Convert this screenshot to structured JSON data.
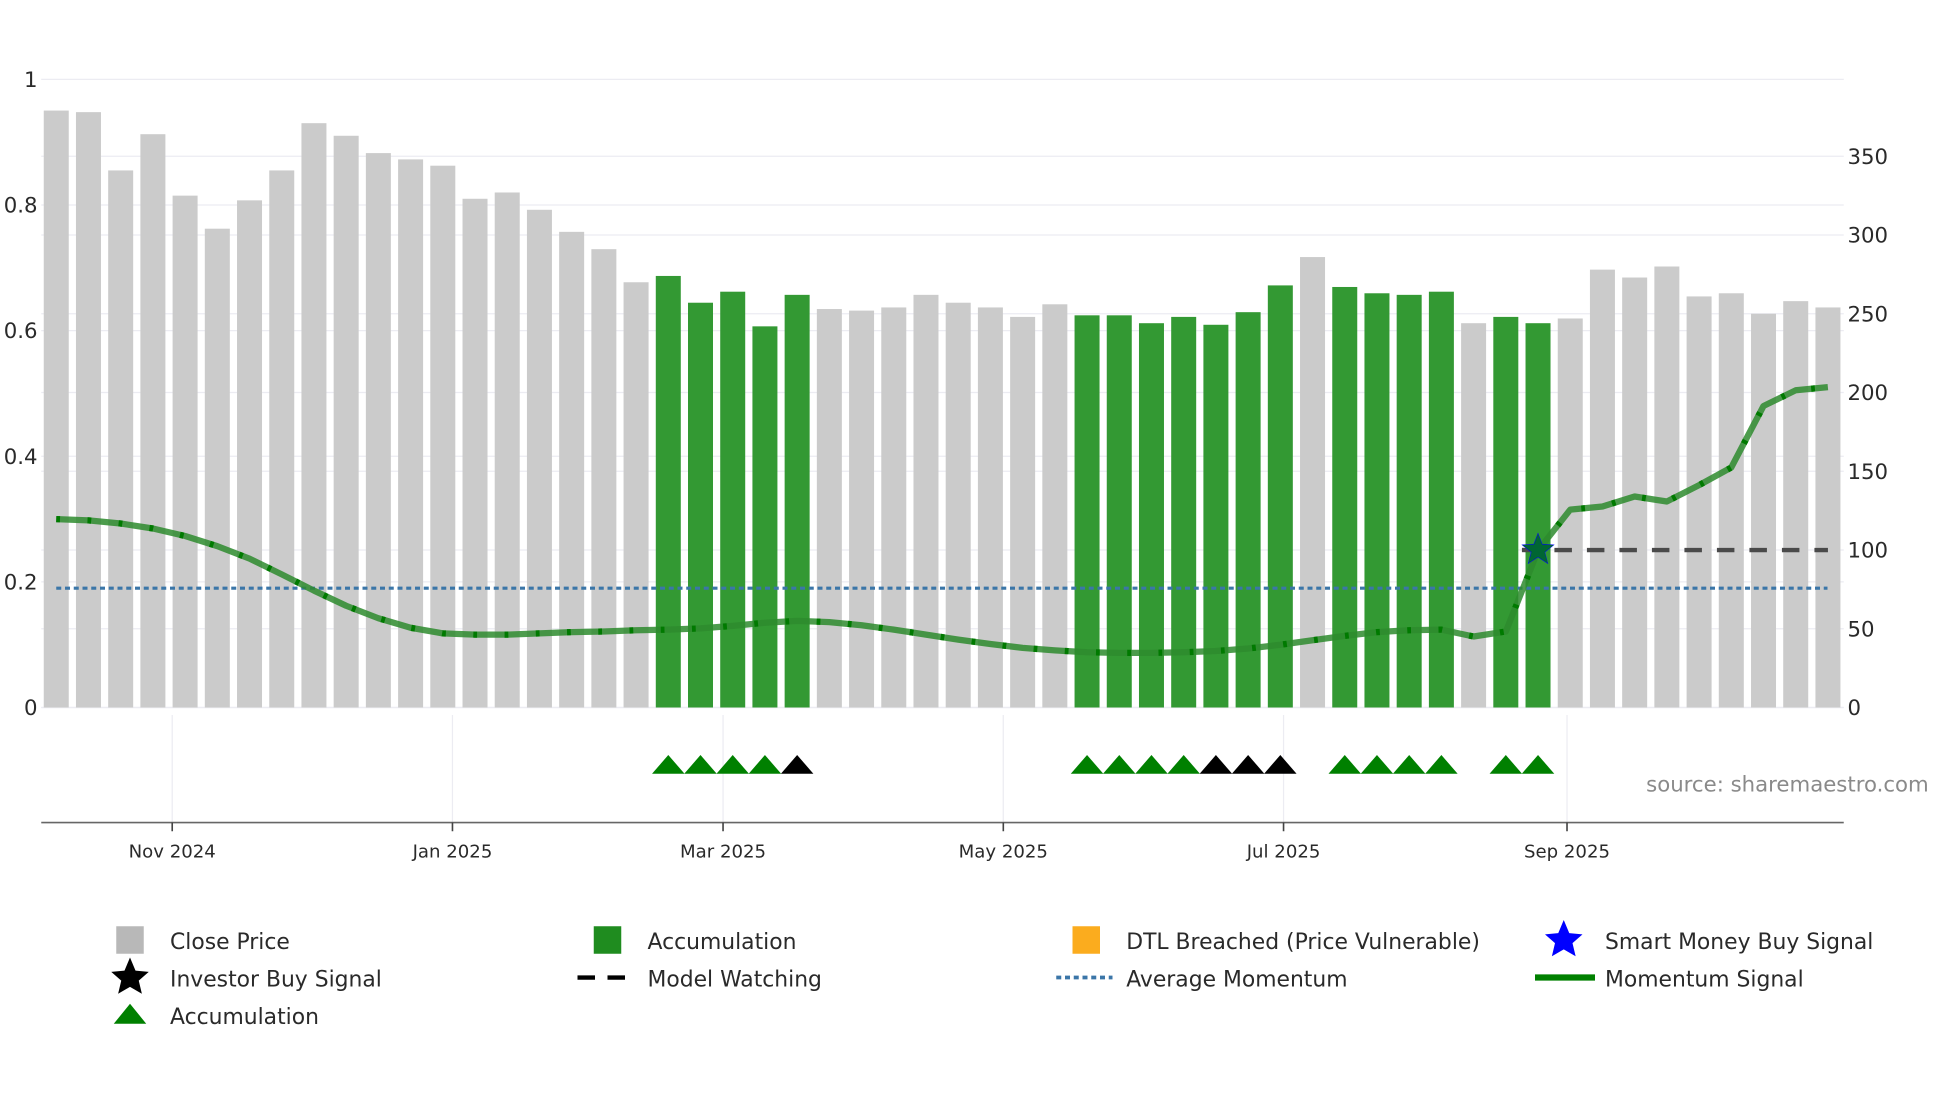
{
  "chart_data": {
    "type": "bar",
    "source": "source: sharemaestro.com",
    "left_axis": {
      "ticks": [
        "0",
        "0.2",
        "0.4",
        "0.6",
        "0.8",
        "1"
      ],
      "range": [
        0,
        1
      ]
    },
    "right_axis": {
      "ticks": [
        "0",
        "50",
        "100",
        "150",
        "200",
        "250",
        "300",
        "350"
      ],
      "range": [
        0,
        400
      ]
    },
    "x_ticks": [
      {
        "label": "Nov 2024",
        "bar_index": 3.6
      },
      {
        "label": "Jan 2025",
        "bar_index": 12.3
      },
      {
        "label": "Mar 2025",
        "bar_index": 20.7
      },
      {
        "label": "May 2025",
        "bar_index": 29.4
      },
      {
        "label": "Jul 2025",
        "bar_index": 38.1
      },
      {
        "label": "Sep 2025",
        "bar_index": 46.9
      }
    ],
    "close_price": [
      379,
      378,
      341,
      364,
      325,
      304,
      322,
      341,
      371,
      363,
      352,
      348,
      344,
      323,
      327,
      316,
      302,
      291,
      270,
      274,
      257,
      264,
      242,
      262,
      253,
      252,
      254,
      262,
      257,
      254,
      248,
      256,
      249,
      249,
      244,
      248,
      243,
      251,
      268,
      286,
      267,
      263,
      262,
      264,
      244,
      248,
      244,
      247,
      278,
      273,
      280,
      261,
      263,
      250,
      258,
      254
    ],
    "accumulation_bars": [
      19,
      20,
      21,
      22,
      23,
      32,
      33,
      34,
      35,
      36,
      37,
      38,
      40,
      41,
      42,
      43,
      45,
      46
    ],
    "momentum_signal": [
      0.3,
      0.298,
      0.293,
      0.285,
      0.273,
      0.257,
      0.237,
      0.212,
      0.186,
      0.162,
      0.142,
      0.127,
      0.118,
      0.116,
      0.116,
      0.118,
      0.12,
      0.121,
      0.123,
      0.124,
      0.126,
      0.13,
      0.135,
      0.138,
      0.136,
      0.131,
      0.124,
      0.116,
      0.108,
      0.101,
      0.095,
      0.091,
      0.088,
      0.087,
      0.087,
      0.088,
      0.09,
      0.094,
      0.1,
      0.107,
      0.114,
      0.12,
      0.123,
      0.124,
      0.113,
      0.121,
      0.25,
      0.315,
      0.32,
      0.336,
      0.328,
      0.354,
      0.382,
      0.48,
      0.505,
      0.51
    ],
    "average_momentum": 0.19,
    "model_watching": {
      "value": 100,
      "from_bar": 45.5,
      "to_bar": 55
    },
    "investor_buy_signal": {
      "bar": 46,
      "value": 100
    },
    "accumulation_markers": [
      {
        "bar": 19,
        "color": "green"
      },
      {
        "bar": 20,
        "color": "green"
      },
      {
        "bar": 21,
        "color": "green"
      },
      {
        "bar": 22,
        "color": "green"
      },
      {
        "bar": 23,
        "color": "black"
      },
      {
        "bar": 32,
        "color": "green"
      },
      {
        "bar": 33,
        "color": "green"
      },
      {
        "bar": 34,
        "color": "green"
      },
      {
        "bar": 35,
        "color": "green"
      },
      {
        "bar": 36,
        "color": "black"
      },
      {
        "bar": 37,
        "color": "black"
      },
      {
        "bar": 38,
        "color": "black"
      },
      {
        "bar": 40,
        "color": "green"
      },
      {
        "bar": 41,
        "color": "green"
      },
      {
        "bar": 42,
        "color": "green"
      },
      {
        "bar": 43,
        "color": "green"
      },
      {
        "bar": 45,
        "color": "green"
      },
      {
        "bar": 46,
        "color": "green"
      }
    ],
    "colors": {
      "close_price": "#cbcbcb",
      "accumulation": "#339933",
      "dtl": "#fbac1e",
      "smart_money": "#0000ff",
      "investor": "#000000",
      "momentum": "#2e8b2e",
      "avg_momentum": "#3b76a8",
      "marker_green": "#008000"
    },
    "legend": [
      {
        "label": "Close Price",
        "icon": "gray-square"
      },
      {
        "label": "Accumulation",
        "icon": "green-square"
      },
      {
        "label": "DTL Breached (Price Vulnerable)",
        "icon": "orange-square"
      },
      {
        "label": "Smart Money Buy Signal",
        "icon": "blue-star"
      },
      {
        "label": "Investor Buy Signal",
        "icon": "black-star"
      },
      {
        "label": "Model Watching",
        "icon": "dashed-line"
      },
      {
        "label": "Average Momentum",
        "icon": "dotted-line"
      },
      {
        "label": "Momentum Signal",
        "icon": "green-line"
      },
      {
        "label": "Accumulation",
        "icon": "green-triangle"
      }
    ]
  }
}
